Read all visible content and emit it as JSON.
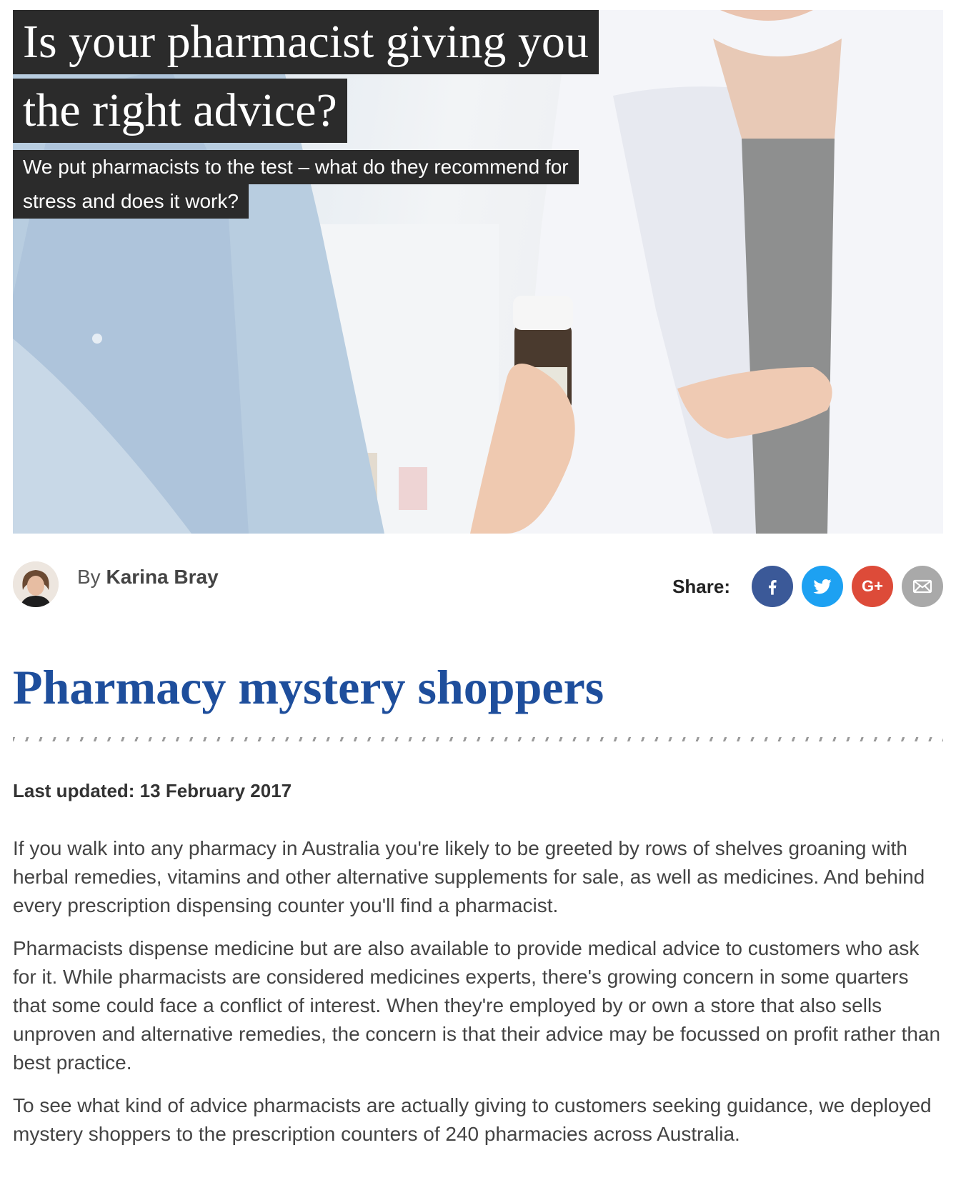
{
  "hero": {
    "title_line1": "Is your pharmacist giving you",
    "title_line2": "the right advice?",
    "subtitle_line1": "We put pharmacists to the test – what do they recommend for",
    "subtitle_line2": "stress and does it work?"
  },
  "byline": {
    "prefix": "By",
    "author": "Karina Bray"
  },
  "share": {
    "label": "Share:",
    "buttons": [
      {
        "name": "facebook",
        "icon": "facebook-icon",
        "color": "#3b5998"
      },
      {
        "name": "twitter",
        "icon": "twitter-icon",
        "color": "#1da1f2"
      },
      {
        "name": "google-plus",
        "icon": "google-plus-icon",
        "label": "G+",
        "color": "#dd4b39"
      },
      {
        "name": "email",
        "icon": "email-icon",
        "color": "#a9a9a9"
      }
    ]
  },
  "article": {
    "title": "Pharmacy mystery shoppers",
    "title_color": "#1e4e9c",
    "last_updated": "Last updated: 13 February 2017",
    "paragraphs": [
      "If you walk into any pharmacy in Australia you're likely to be greeted by rows of shelves groaning with herbal remedies, vitamins and other alternative supplements for sale, as well as medicines. And behind every prescription dispensing counter you'll find a pharmacist.",
      "Pharmacists dispense medicine but are also available to provide medical advice to customers who ask for it. While pharmacists are considered medicines experts, there's growing concern in some quarters that some could face a conflict of interest. When they're employed by or own a store that also sells unproven and alternative remedies, the concern is that their advice may be focussed on profit rather than best practice.",
      "To see what kind of advice pharmacists are actually giving to customers seeking guidance, we deployed mystery shoppers to the prescription counters of 240 pharmacies across Australia."
    ]
  }
}
